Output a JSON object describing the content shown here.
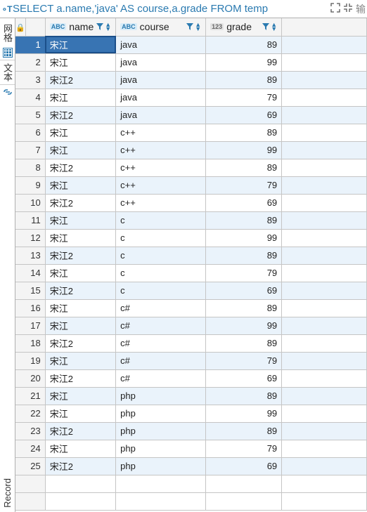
{
  "sql_bar": {
    "icon": "oT",
    "query": "SELECT a.name,'java' AS course,a.grade FROM temp",
    "output_label": "输"
  },
  "sidebar": {
    "panel_label": "网格",
    "text_label": "文本",
    "record_label": "Record"
  },
  "columns": [
    {
      "name": "name",
      "type": "ABC"
    },
    {
      "name": "course",
      "type": "ABC"
    },
    {
      "name": "grade",
      "type": "123"
    }
  ],
  "rows": [
    {
      "n": 1,
      "name": "宋江",
      "course": "java",
      "grade": 89,
      "selected": true
    },
    {
      "n": 2,
      "name": "宋江",
      "course": "java",
      "grade": 99
    },
    {
      "n": 3,
      "name": "宋江2",
      "course": "java",
      "grade": 89
    },
    {
      "n": 4,
      "name": "宋江",
      "course": "java",
      "grade": 79
    },
    {
      "n": 5,
      "name": "宋江2",
      "course": "java",
      "grade": 69
    },
    {
      "n": 6,
      "name": "宋江",
      "course": "c++",
      "grade": 89
    },
    {
      "n": 7,
      "name": "宋江",
      "course": "c++",
      "grade": 99
    },
    {
      "n": 8,
      "name": "宋江2",
      "course": "c++",
      "grade": 89
    },
    {
      "n": 9,
      "name": "宋江",
      "course": "c++",
      "grade": 79
    },
    {
      "n": 10,
      "name": "宋江2",
      "course": "c++",
      "grade": 69
    },
    {
      "n": 11,
      "name": "宋江",
      "course": "c",
      "grade": 89
    },
    {
      "n": 12,
      "name": "宋江",
      "course": "c",
      "grade": 99
    },
    {
      "n": 13,
      "name": "宋江2",
      "course": "c",
      "grade": 89
    },
    {
      "n": 14,
      "name": "宋江",
      "course": "c",
      "grade": 79
    },
    {
      "n": 15,
      "name": "宋江2",
      "course": "c",
      "grade": 69
    },
    {
      "n": 16,
      "name": "宋江",
      "course": "c#",
      "grade": 89
    },
    {
      "n": 17,
      "name": "宋江",
      "course": "c#",
      "grade": 99
    },
    {
      "n": 18,
      "name": "宋江2",
      "course": "c#",
      "grade": 89
    },
    {
      "n": 19,
      "name": "宋江",
      "course": "c#",
      "grade": 79
    },
    {
      "n": 20,
      "name": "宋江2",
      "course": "c#",
      "grade": 69
    },
    {
      "n": 21,
      "name": "宋江",
      "course": "php",
      "grade": 89
    },
    {
      "n": 22,
      "name": "宋江",
      "course": "php",
      "grade": 99
    },
    {
      "n": 23,
      "name": "宋江2",
      "course": "php",
      "grade": 89
    },
    {
      "n": 24,
      "name": "宋江",
      "course": "php",
      "grade": 79
    },
    {
      "n": 25,
      "name": "宋江2",
      "course": "php",
      "grade": 69
    }
  ]
}
